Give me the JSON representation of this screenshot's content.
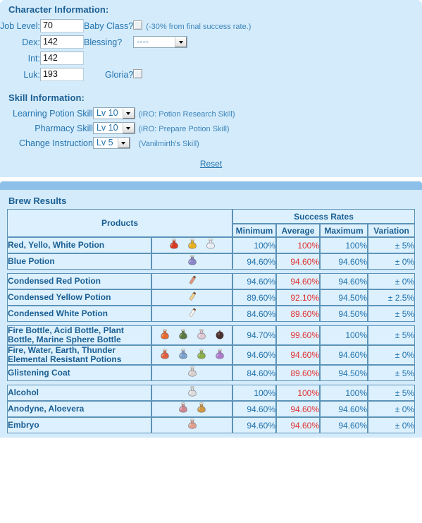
{
  "character": {
    "title": "Character Information:",
    "job_level": {
      "label": "Job Level:",
      "value": "70"
    },
    "dex": {
      "label": "Dex:",
      "value": "142"
    },
    "int": {
      "label": "Int:",
      "value": "142"
    },
    "luk": {
      "label": "Luk:",
      "value": "193"
    },
    "baby_class": {
      "label": "Baby Class?",
      "checked": false,
      "note": "(-30% from final success rate.)"
    },
    "blessing": {
      "label": "Blessing?",
      "value": "----"
    },
    "gloria": {
      "label": "Gloria?",
      "checked": false
    }
  },
  "skills": {
    "title": "Skill Information:",
    "learning_potion": {
      "label": "Learning Potion Skill",
      "value": "Lv 10",
      "note": "(iRO: Potion Research Skill)"
    },
    "pharmacy": {
      "label": "Pharmacy Skill",
      "value": "Lv 10",
      "note": "(iRO: Prepare Potion Skill)"
    },
    "change_instruction": {
      "label": "Change Instruction",
      "value": "Lv 5",
      "note": "(Vanilmirth's Skill)"
    }
  },
  "reset_label": "Reset",
  "results": {
    "title": "Brew Results",
    "header_products": "Products",
    "header_success_rates": "Success Rates",
    "columns": [
      "Minimum",
      "Average",
      "Maximum",
      "Variation"
    ],
    "groups": [
      {
        "rows": [
          {
            "name": "Red, Yello, White Potion",
            "icons": [
              "red-potion-icon",
              "yellow-potion-icon",
              "white-potion-icon"
            ],
            "minimum": "100%",
            "average": "100%",
            "maximum": "100%",
            "variation": "± 5%"
          },
          {
            "name": "Blue Potion",
            "icons": [
              "blue-potion-icon"
            ],
            "minimum": "94.60%",
            "average": "94.60%",
            "maximum": "94.60%",
            "variation": "± 0%"
          }
        ]
      },
      {
        "rows": [
          {
            "name": "Condensed Red Potion",
            "icons": [
              "condensed-red-potion-icon"
            ],
            "minimum": "94.60%",
            "average": "94.60%",
            "maximum": "94.60%",
            "variation": "± 0%"
          },
          {
            "name": "Condensed Yellow Potion",
            "icons": [
              "condensed-yellow-potion-icon"
            ],
            "minimum": "89.60%",
            "average": "92.10%",
            "maximum": "94.50%",
            "variation": "± 2.5%"
          },
          {
            "name": "Condensed White Potion",
            "icons": [
              "condensed-white-potion-icon"
            ],
            "minimum": "84.60%",
            "average": "89.60%",
            "maximum": "94.50%",
            "variation": "± 5%"
          }
        ]
      },
      {
        "rows": [
          {
            "name": "Fire Bottle, Acid Bottle, Plant Bottle, Marine Sphere Bottle",
            "icons": [
              "fire-bottle-icon",
              "acid-bottle-icon",
              "plant-bottle-icon",
              "marine-sphere-bottle-icon"
            ],
            "minimum": "94.70%",
            "average": "99.60%",
            "maximum": "100%",
            "variation": "± 5%"
          },
          {
            "name": "Fire, Water, Earth, Thunder Elemental Resistant Potions",
            "icons": [
              "fire-resist-potion-icon",
              "water-resist-potion-icon",
              "earth-resist-potion-icon",
              "thunder-resist-potion-icon"
            ],
            "minimum": "94.60%",
            "average": "94.60%",
            "maximum": "94.60%",
            "variation": "± 0%"
          },
          {
            "name": "Glistening Coat",
            "icons": [
              "glistening-coat-icon"
            ],
            "minimum": "84.60%",
            "average": "89.60%",
            "maximum": "94.50%",
            "variation": "± 5%"
          }
        ]
      },
      {
        "rows": [
          {
            "name": "Alcohol",
            "icons": [
              "alcohol-icon"
            ],
            "minimum": "100%",
            "average": "100%",
            "maximum": "100%",
            "variation": "± 5%"
          },
          {
            "name": "Anodyne, Aloevera",
            "icons": [
              "anodyne-icon",
              "aloevera-icon"
            ],
            "minimum": "94.60%",
            "average": "94.60%",
            "maximum": "94.60%",
            "variation": "± 0%"
          },
          {
            "name": "Embryo",
            "icons": [
              "embryo-icon"
            ],
            "minimum": "94.60%",
            "average": "94.60%",
            "maximum": "94.60%",
            "variation": "± 0%"
          }
        ]
      }
    ]
  },
  "colors": {
    "panel_bg": "#d4ebfb",
    "band": "#8cc0e8",
    "heading": "#1b5f93",
    "label": "#2273ae",
    "average_highlight": "#e03030",
    "table_border": "#5d93b8",
    "cell_bg": "#dcf0fd"
  }
}
